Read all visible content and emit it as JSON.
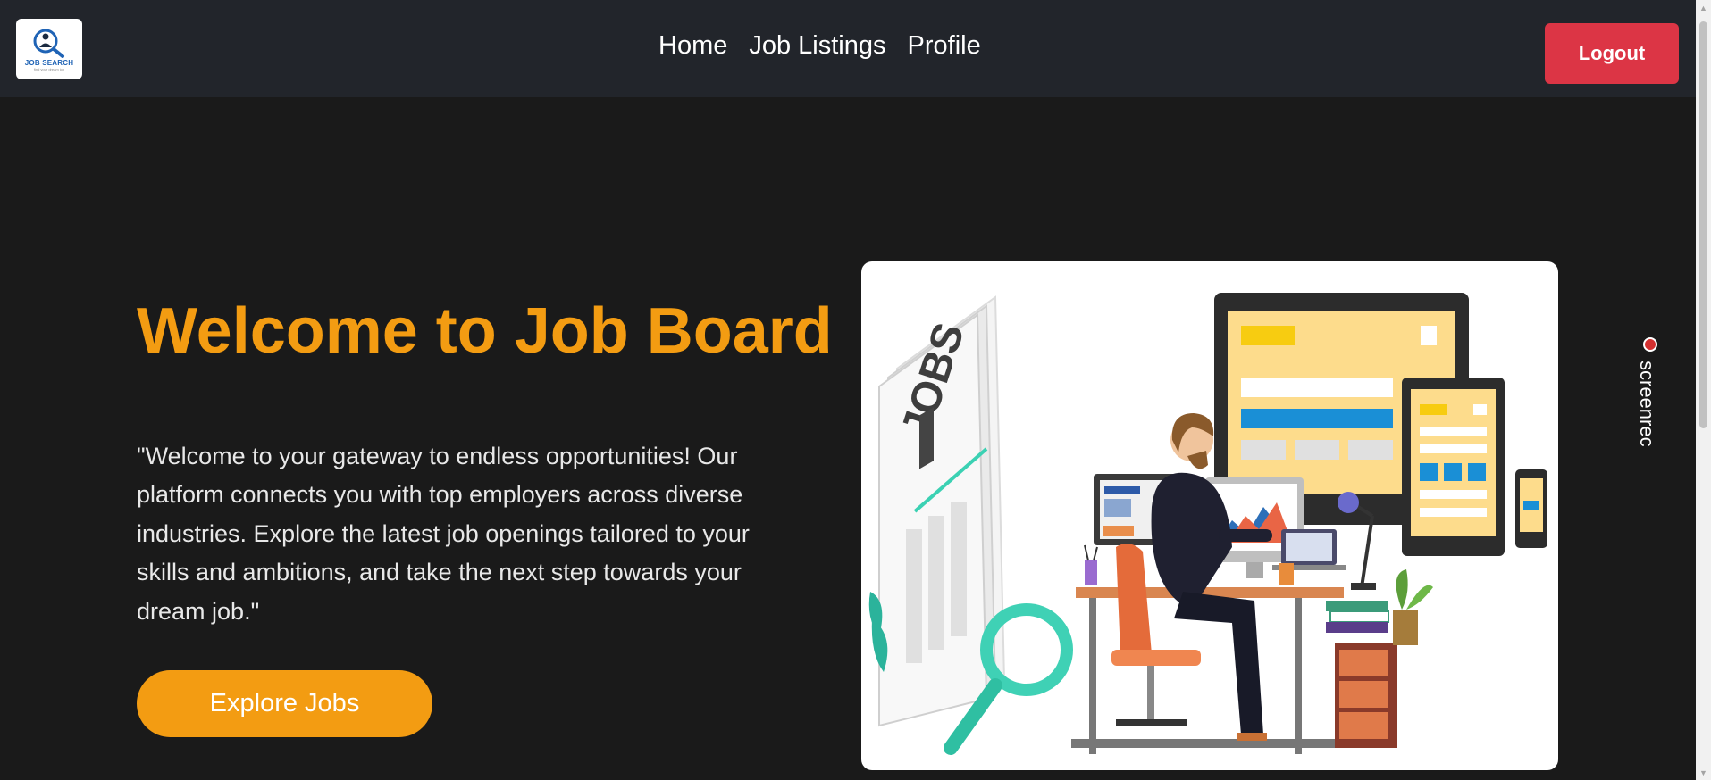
{
  "header": {
    "logo_text": "JOB SEARCH",
    "logo_subtext": "find your dream job",
    "nav": [
      {
        "label": "Home"
      },
      {
        "label": "Job Listings"
      },
      {
        "label": "Profile"
      }
    ],
    "logout_label": "Logout"
  },
  "hero": {
    "title": "Welcome to Job Board",
    "description": "\"Welcome to your gateway to endless opportunities! Our platform connects you with top employers across diverse industries. Explore the latest job openings tailored to your skills and ambitions, and take the next step towards your dream job.\"",
    "cta_label": "Explore Jobs",
    "illustration_newspaper_text": "JOBS"
  },
  "screenrec": {
    "label": "screenrec"
  },
  "colors": {
    "header_bg": "#22252b",
    "page_bg": "#1a1a1a",
    "accent": "#f39c12",
    "logout": "#dc3545"
  }
}
